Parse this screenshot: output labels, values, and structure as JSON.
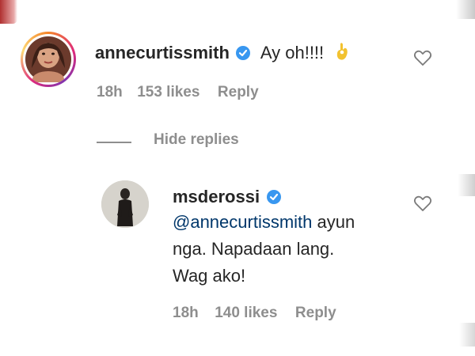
{
  "comments": [
    {
      "username": "annecurtissmith",
      "text": "Ay oh!!!!",
      "emoji": "👌",
      "time": "18h",
      "likes": "153 likes",
      "reply": "Reply"
    }
  ],
  "hide_replies": "Hide replies",
  "replies": [
    {
      "username": "msderossi",
      "mention": "@annecurtissmith",
      "text_line1_rest": " ayun",
      "text_line2": "nga. Napadaan lang.",
      "text_line3": "Wag ako!",
      "time": "18h",
      "likes": "140 likes",
      "reply": "Reply"
    }
  ],
  "colors": {
    "verified": "#3897f0",
    "meta": "#8e8e8e",
    "mention": "#00376b",
    "emoji": "#f2c230"
  },
  "icons": {
    "verified": "verified-badge-icon",
    "like": "heart-outline-icon",
    "emoji": "ok-hand-icon"
  }
}
